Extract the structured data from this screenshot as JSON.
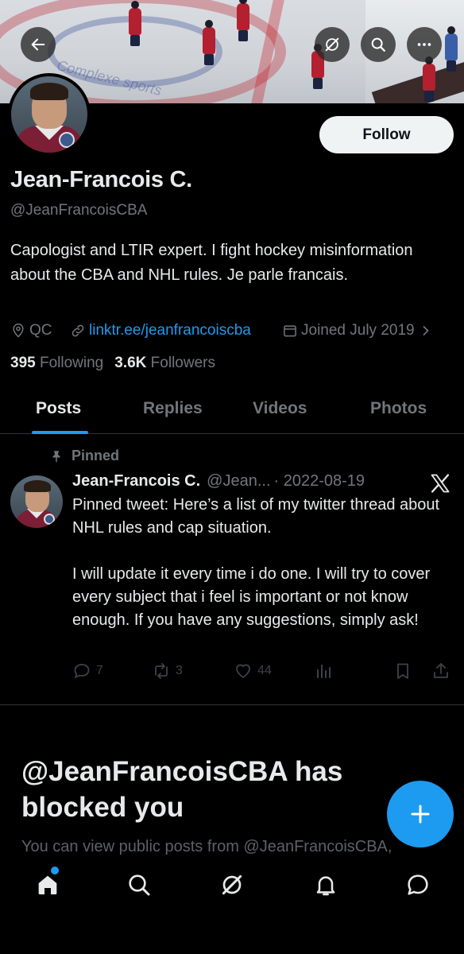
{
  "banner": {
    "rink_text": "Complexe sports"
  },
  "profile": {
    "name": "Jean-Francois C.",
    "handle": "@JeanFrancoisCBA",
    "bio": "Capologist and LTIR expert. I fight hockey misinformation about the CBA and NHL rules. Je parle francais.",
    "location": "QC",
    "link": "linktr.ee/jeanfrancoiscba",
    "joined": "Joined July 2019",
    "following_count": "395",
    "following_label": "Following",
    "followers_count": "3.6K",
    "followers_label": "Followers",
    "follow_label": "Follow"
  },
  "tabs": [
    "Posts",
    "Replies",
    "Videos",
    "Photos"
  ],
  "active_tab": "Posts",
  "pinned": {
    "label": "Pinned",
    "name": "Jean-Francois C.",
    "handle": "@Jean...",
    "date": "· 2022-08-19",
    "text": "Pinned tweet: Here’s a list of my twitter thread about NHL rules and cap situation.\n\nI will update it every time i do one. I will try to cover every subject that i feel is important or not know enough. If you have any suggestions, simply ask!",
    "replies": "7",
    "reposts": "3",
    "likes": "44"
  },
  "blocked": {
    "title": "@JeanFrancoisCBA has blocked you",
    "subtitle": "You can view public posts from @JeanFrancoisCBA,"
  },
  "icons": {
    "back": "arrow-left-icon",
    "grok": "grok-icon",
    "search": "search-icon",
    "more": "more-icon",
    "compose": "plus-icon",
    "nav": [
      "home-icon",
      "search-icon",
      "grok-icon",
      "bell-icon",
      "chat-icon"
    ]
  },
  "colors": {
    "accent": "#1d9bf0",
    "background": "#000000",
    "text": "#e7e9ea",
    "muted": "#71767b"
  }
}
